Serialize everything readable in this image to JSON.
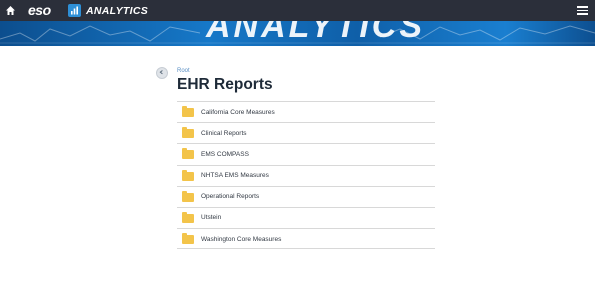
{
  "header": {
    "brand": "eso",
    "app_title": "ANALYTICS",
    "banner_text": "ANALYTICS"
  },
  "breadcrumb": "Root",
  "page_title": "EHR Reports",
  "folders": [
    "California Core Measures",
    "Clinical Reports",
    "EMS COMPASS",
    "NHTSA EMS Measures",
    "Operational Reports",
    "Utstein",
    "Washington Core Measures"
  ],
  "colors": {
    "topbar": "#2b2f3a",
    "accent": "#2e8fd6",
    "folder": "#f3c44a"
  }
}
